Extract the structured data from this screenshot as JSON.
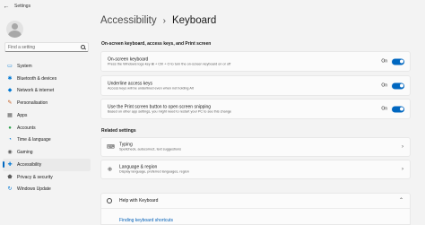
{
  "window": {
    "title": "Settings",
    "back_icon": "back-arrow-icon"
  },
  "search": {
    "placeholder": "Find a setting"
  },
  "sidebar": {
    "items": [
      {
        "label": "System",
        "icon": "monitor-icon",
        "glyph": "▭",
        "color": "#0078d4"
      },
      {
        "label": "Bluetooth & devices",
        "icon": "bluetooth-icon",
        "glyph": "✱",
        "color": "#0078d4"
      },
      {
        "label": "Network & internet",
        "icon": "wifi-icon",
        "glyph": "◆",
        "color": "#0078d4"
      },
      {
        "label": "Personalisation",
        "icon": "brush-icon",
        "glyph": "✎",
        "color": "#c2571a"
      },
      {
        "label": "Apps",
        "icon": "apps-icon",
        "glyph": "▦",
        "color": "#5c5c5c"
      },
      {
        "label": "Accounts",
        "icon": "person-icon",
        "glyph": "●",
        "color": "#2ba14b"
      },
      {
        "label": "Time & language",
        "icon": "globe-clock-icon",
        "glyph": "◔",
        "color": "#0078d4"
      },
      {
        "label": "Gaming",
        "icon": "gamepad-icon",
        "glyph": "◉",
        "color": "#5c5c5c"
      },
      {
        "label": "Accessibility",
        "icon": "accessibility-icon",
        "glyph": "✚",
        "color": "#0078d4",
        "active": true
      },
      {
        "label": "Privacy & security",
        "icon": "shield-icon",
        "glyph": "⬟",
        "color": "#5c5c5c"
      },
      {
        "label": "Windows Update",
        "icon": "refresh-icon",
        "glyph": "↻",
        "color": "#0078d4"
      }
    ]
  },
  "breadcrumb": {
    "parent": "Accessibility",
    "separator": "›",
    "current": "Keyboard"
  },
  "section1": {
    "title": "On-screen keyboard, access keys, and Print screen",
    "rows": [
      {
        "title": "On-screen keyboard",
        "subtitle": "Press the Windows logo key ⊞ + Ctrl + O to turn the on-screen keyboard on or off",
        "state": "On"
      },
      {
        "title": "Underline access keys",
        "subtitle": "Access keys will be underlined even when not holding Alt",
        "state": "On"
      },
      {
        "title": "Use the Print screen button to open screen snipping",
        "subtitle": "Based on other app settings, you might need to restart your PC to see this change",
        "state": "On"
      }
    ]
  },
  "related": {
    "title": "Related settings",
    "rows": [
      {
        "title": "Typing",
        "subtitle": "Spellcheck, autocorrect, text suggestions",
        "icon": "keyboard-icon"
      },
      {
        "title": "Language & region",
        "subtitle": "Display language, preferred languages, region",
        "icon": "language-icon"
      }
    ]
  },
  "help": {
    "title": "Help with Keyboard",
    "link": "Finding keyboard shortcuts"
  },
  "colors": {
    "accent": "#0067c0",
    "background": "#f3f3f3",
    "card": "#fbfbfb",
    "link": "#005fb8"
  }
}
